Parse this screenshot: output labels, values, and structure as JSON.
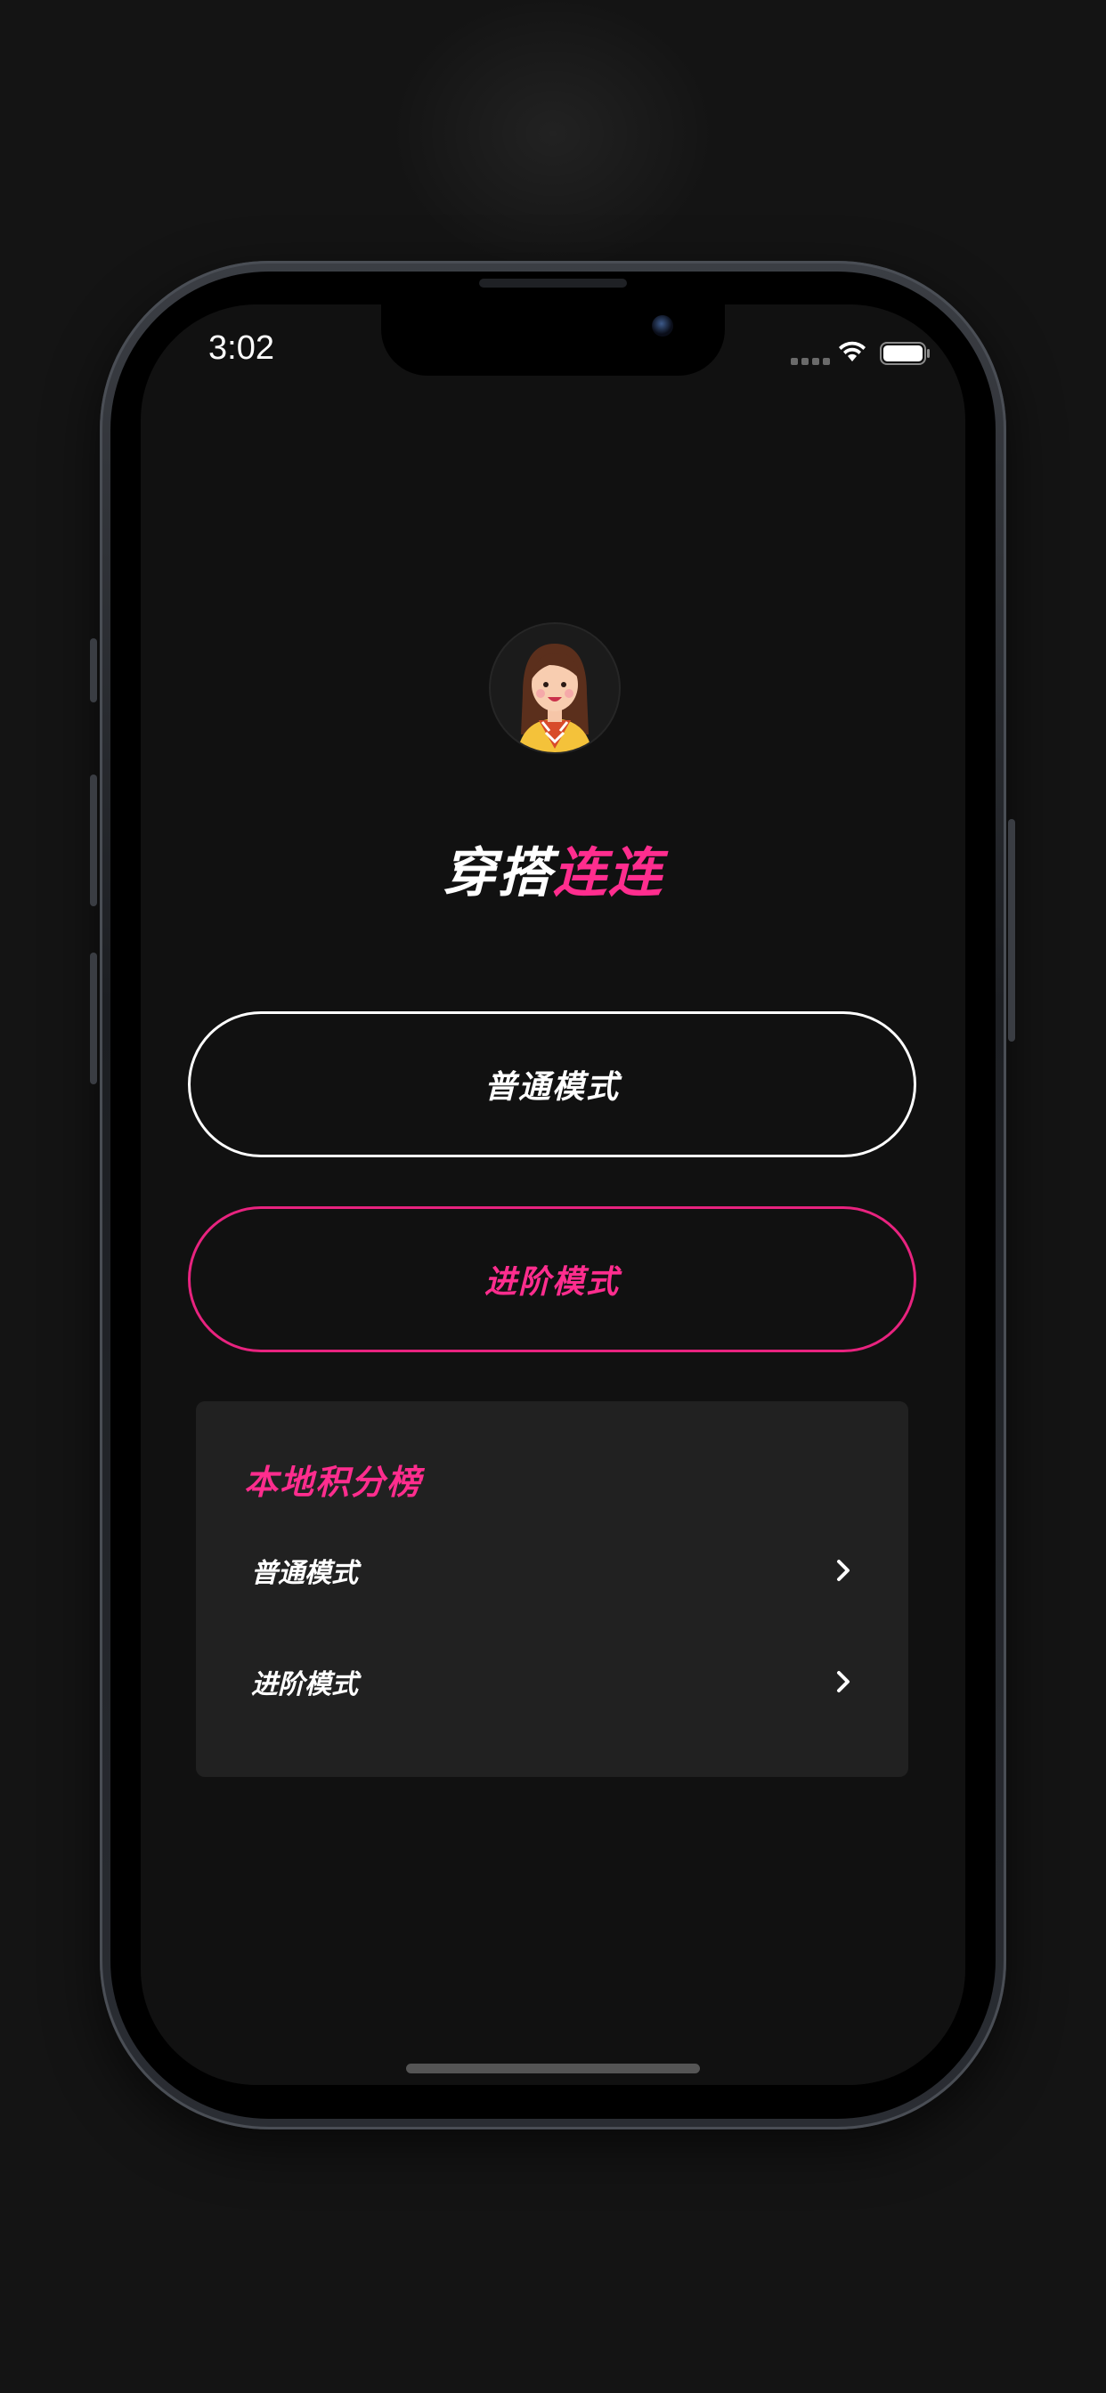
{
  "status_bar": {
    "time": "3:02"
  },
  "app": {
    "title_part1": "穿搭",
    "title_part2": "连连",
    "accent_color": "#ff2d8e"
  },
  "buttons": {
    "normal_mode": "普通模式",
    "advanced_mode": "进阶模式"
  },
  "leaderboard": {
    "title": "本地积分榜",
    "rows": [
      {
        "label": "普通模式",
        "icon": "chevron-right-icon"
      },
      {
        "label": "进阶模式",
        "icon": "chevron-right-icon"
      }
    ]
  }
}
